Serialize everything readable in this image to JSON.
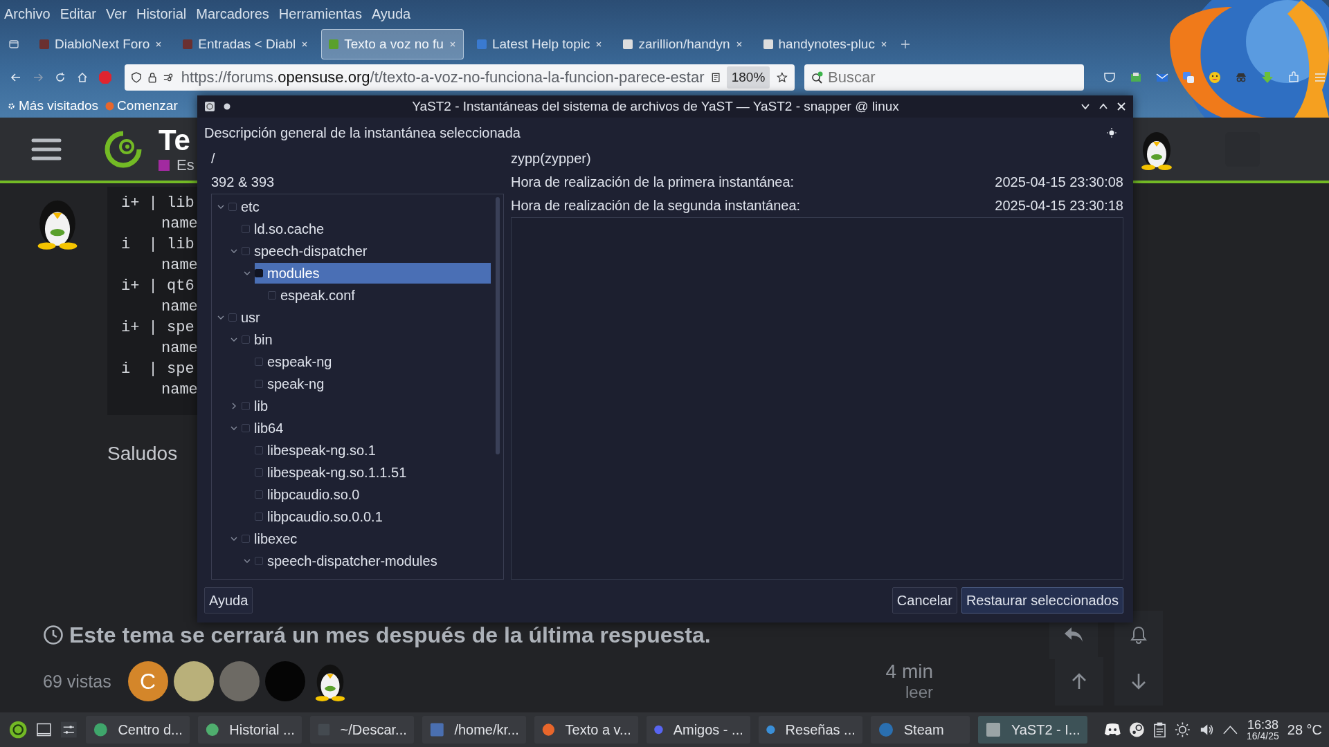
{
  "browser": {
    "menu": [
      "Archivo",
      "Editar",
      "Ver",
      "Historial",
      "Marcadores",
      "Herramientas",
      "Ayuda"
    ],
    "tabs": [
      {
        "label": "DiabloNext Foro",
        "selected": false
      },
      {
        "label": "Entradas < Diabl",
        "selected": false
      },
      {
        "label": "Texto a voz no fu",
        "selected": true
      },
      {
        "label": "Latest Help topic",
        "selected": false
      },
      {
        "label": "zarillion/handyn",
        "selected": false
      },
      {
        "label": "handynotes-pluc",
        "selected": false
      }
    ],
    "url": {
      "prefix": "https://forums.",
      "domain": "opensuse.org",
      "path": "/t/texto-a-voz-no-funciona-la-funcion-parece-estar"
    },
    "zoom": "180%",
    "search": {
      "placeholder": "Buscar"
    },
    "bookmarks": [
      "Más visitados",
      "Comenzar"
    ]
  },
  "page": {
    "title": "Te",
    "category": "Es",
    "code_lines": [
      {
        "kind": "entry",
        "text": "i+ | lib"
      },
      {
        "kind": "name",
        "text": "name"
      },
      {
        "kind": "entry",
        "text": "i  | lib"
      },
      {
        "kind": "name",
        "text": "name"
      },
      {
        "kind": "entry",
        "text": "i+ | qt6"
      },
      {
        "kind": "name",
        "text": "name"
      },
      {
        "kind": "entry",
        "text": "i+ | spe"
      },
      {
        "kind": "name",
        "text": "name"
      },
      {
        "kind": "entry",
        "text": "i  | spe"
      },
      {
        "kind": "name",
        "text": "name"
      }
    ],
    "reply": "Saludos",
    "notice": "Este tema se cerrará un mes después de la última respuesta.",
    "views": "69 vistas",
    "avatar_letter": "C",
    "read_time": "4 min",
    "read_label": "leer"
  },
  "dialog": {
    "title": "YaST2 - Instantáneas del sistema de archivos de YaST — YaST2 - snapper @ linux",
    "heading": "Descripción general de la instantánea seleccionada",
    "path": "/",
    "snapshots": "392 & 393",
    "description": "zypp(zypper)",
    "details": [
      {
        "label": "Hora de realización de la primera instantánea:",
        "value": "2025-04-15 23:30:08"
      },
      {
        "label": "Hora de realización de la segunda instantánea:",
        "value": "2025-04-15 23:30:18"
      }
    ],
    "tree": [
      {
        "label": "etc",
        "expanded": true,
        "selected": false,
        "children": [
          {
            "label": "ld.so.cache",
            "selected": false
          },
          {
            "label": "speech-dispatcher",
            "expanded": true,
            "selected": false,
            "children": [
              {
                "label": "modules",
                "expanded": true,
                "selected": true,
                "children": [
                  {
                    "label": "espeak.conf",
                    "selected": false
                  }
                ]
              }
            ]
          }
        ]
      },
      {
        "label": "usr",
        "expanded": true,
        "selected": false,
        "children": [
          {
            "label": "bin",
            "expanded": true,
            "selected": false,
            "children": [
              {
                "label": "espeak-ng",
                "selected": false
              },
              {
                "label": "speak-ng",
                "selected": false
              }
            ]
          },
          {
            "label": "lib",
            "expanded": false,
            "selected": false
          },
          {
            "label": "lib64",
            "expanded": true,
            "selected": false,
            "children": [
              {
                "label": "libespeak-ng.so.1",
                "selected": false
              },
              {
                "label": "libespeak-ng.so.1.1.51",
                "selected": false
              },
              {
                "label": "libpcaudio.so.0",
                "selected": false
              },
              {
                "label": "libpcaudio.so.0.0.1",
                "selected": false
              }
            ]
          },
          {
            "label": "libexec",
            "expanded": true,
            "selected": false,
            "children": [
              {
                "label": "speech-dispatcher-modules",
                "expanded": true,
                "selected": false
              }
            ]
          }
        ]
      }
    ],
    "help_button": "Ayuda",
    "cancel_button": "Cancelar",
    "ok_button": "Restaurar seleccionados"
  },
  "taskbar": {
    "items": [
      {
        "label": "Centro d...",
        "selected": false
      },
      {
        "label": "Historial ...",
        "selected": false
      },
      {
        "label": "~/Descar...",
        "selected": false
      },
      {
        "label": "/home/kr...",
        "selected": false
      },
      {
        "label": "Texto a v...",
        "selected": false
      },
      {
        "label": "Amigos - ...",
        "selected": false
      },
      {
        "label": "Reseñas ...",
        "selected": false
      },
      {
        "label": "Steam",
        "selected": false
      },
      {
        "label": "YaST2 - I...",
        "selected": true
      }
    ],
    "time": "16:38",
    "date": "16/4/25",
    "weather": "28 °C"
  }
}
